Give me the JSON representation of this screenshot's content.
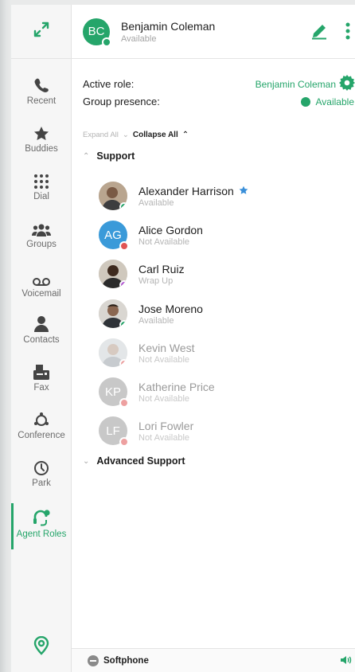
{
  "colors": {
    "accent": "#25a56a",
    "available": "#25a56a",
    "not_available": "#e05454",
    "wrap_up": "#b45bd6"
  },
  "sidebar": {
    "top_icon": "expand-arrows-icon",
    "items": [
      {
        "label": "Recent",
        "icon": "phone-icon"
      },
      {
        "label": "Buddies",
        "icon": "star-icon"
      },
      {
        "label": "Dial",
        "icon": "dialpad-icon"
      },
      {
        "label": "Groups",
        "icon": "groups-icon"
      },
      {
        "label": "Voicemail",
        "icon": "voicemail-icon"
      },
      {
        "label": "Contacts",
        "icon": "contacts-icon"
      },
      {
        "label": "Fax",
        "icon": "fax-icon"
      },
      {
        "label": "Conference",
        "icon": "conference-icon"
      },
      {
        "label": "Park",
        "icon": "park-clock-icon"
      },
      {
        "label": "Agent Roles",
        "icon": "agent-headset-icon",
        "active": true
      }
    ],
    "bottom_icon": "location-pin-icon"
  },
  "header": {
    "initials": "BC",
    "name": "Benjamin Coleman",
    "status": "Available",
    "avatar_color": "#25a56a"
  },
  "roles": {
    "active_role_label": "Active role:",
    "active_role_value": "Benjamin Coleman",
    "group_presence_label": "Group presence:",
    "group_presence_value": "Available"
  },
  "expand_all": "Expand All",
  "collapse_all": "Collapse All",
  "groups": [
    {
      "name": "Support",
      "expanded": true
    },
    {
      "name": "Advanced Support",
      "expanded": false
    }
  ],
  "contacts": [
    {
      "name": "Alexander Harrison",
      "status": "Available",
      "favorite": true,
      "photo": true
    },
    {
      "name": "Alice Gordon",
      "status": "Not Available",
      "initials": "AG",
      "avatar_color": "#3a9ad9"
    },
    {
      "name": "Carl Ruiz",
      "status": "Wrap Up",
      "photo": true
    },
    {
      "name": "Jose Moreno",
      "status": "Available",
      "photo": true
    },
    {
      "name": "Kevin West",
      "status": "Not Available",
      "photo": true,
      "faded": true
    },
    {
      "name": "Katherine Price",
      "status": "Not Available",
      "initials": "KP",
      "avatar_color": "#9c9c9c",
      "faded": true
    },
    {
      "name": "Lori Fowler",
      "status": "Not Available",
      "initials": "LF",
      "avatar_color": "#9c9c9c",
      "faded": true
    }
  ],
  "footer": {
    "softphone_label": "Softphone"
  }
}
